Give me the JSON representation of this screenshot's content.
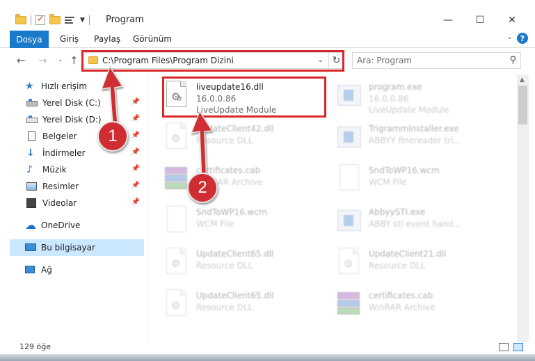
{
  "window": {
    "title": "Program",
    "minimize_label": "—",
    "maximize_label": "☐",
    "close_label": "✕"
  },
  "ribbon": {
    "file_tab": "Dosya",
    "tabs": [
      "Giriş",
      "Paylaş",
      "Görünüm"
    ],
    "expand_icon": "chevron-down-icon",
    "help_label": "?"
  },
  "navigation": {
    "back": "←",
    "forward": "→",
    "recent": "⌄",
    "up": "↑",
    "address_path": "C:\\Program Files\\Program Dizini",
    "address_dropdown": "⌄",
    "refresh": "↻"
  },
  "search": {
    "placeholder": "Ara: Program",
    "icon": "⚲"
  },
  "sidebar": {
    "items": [
      {
        "label": "Hızlı erişim",
        "icon": "star-icon",
        "pinned": false
      },
      {
        "label": "Yerel Disk (C:)",
        "icon": "drive-icon",
        "pinned": true
      },
      {
        "label": "Yerel Disk (D:)",
        "icon": "drive-icon",
        "pinned": true
      },
      {
        "label": "Belgeler",
        "icon": "document-icon",
        "pinned": true
      },
      {
        "label": "İndirmeler",
        "icon": "download-icon",
        "pinned": true
      },
      {
        "label": "Müzik",
        "icon": "music-icon",
        "pinned": true
      },
      {
        "label": "Resimler",
        "icon": "pictures-icon",
        "pinned": true
      },
      {
        "label": "Videolar",
        "icon": "video-icon",
        "pinned": true
      },
      {
        "label": "OneDrive",
        "icon": "cloud-icon",
        "pinned": false
      },
      {
        "label": "Bu bilgisayar",
        "icon": "computer-icon",
        "pinned": false,
        "selected": true
      },
      {
        "label": "Ağ",
        "icon": "network-icon",
        "pinned": false
      }
    ],
    "pin_glyph": "📌"
  },
  "files": [
    {
      "name": "liveupdate16.dll",
      "line2": "16.0.0.86",
      "line3": "LiveUpdate Module",
      "type": "dll",
      "highlighted": true
    },
    {
      "name": "program.exe",
      "line2": "16.0.0.86",
      "line3": "LiveUpdate Module",
      "type": "exe"
    },
    {
      "name": "UpdateClient42.dll",
      "line2": "Resource DLL",
      "line3": "",
      "type": "dll"
    },
    {
      "name": "TrigrammInstaller.exe",
      "line2": "ABBYY finereader tri...",
      "line3": "",
      "type": "exe"
    },
    {
      "name": "certificates.cab",
      "line2": "WinRAR Archive",
      "line3": "",
      "type": "rar"
    },
    {
      "name": "SndToWP16.wcm",
      "line2": "WCM File",
      "line3": "",
      "type": "blank"
    },
    {
      "name": "SndToWP16.wcm",
      "line2": "WCM File",
      "line3": "",
      "type": "blank"
    },
    {
      "name": "AbbyySTI.exe",
      "line2": "ABBY sti event hand...",
      "line3": "",
      "type": "exe"
    },
    {
      "name": "UpdateClient65.dll",
      "line2": "Resource DLL",
      "line3": "",
      "type": "dll"
    },
    {
      "name": "UpdateClient21.dll",
      "line2": "Resource DLL",
      "line3": "",
      "type": "dll"
    },
    {
      "name": "UpdateClient65.dll",
      "line2": "Resource DLL",
      "line3": "",
      "type": "dll"
    },
    {
      "name": "certificates.cab",
      "line2": "WinRAR Archive",
      "line3": "",
      "type": "rar"
    }
  ],
  "annotations": {
    "step1": "1",
    "step2": "2",
    "color": "#cf2d31"
  },
  "status": {
    "item_count": "129 öğe"
  },
  "colors": {
    "accent": "#1979ca",
    "selection": "#cce8ff",
    "highlight_box": "#d9262b"
  }
}
